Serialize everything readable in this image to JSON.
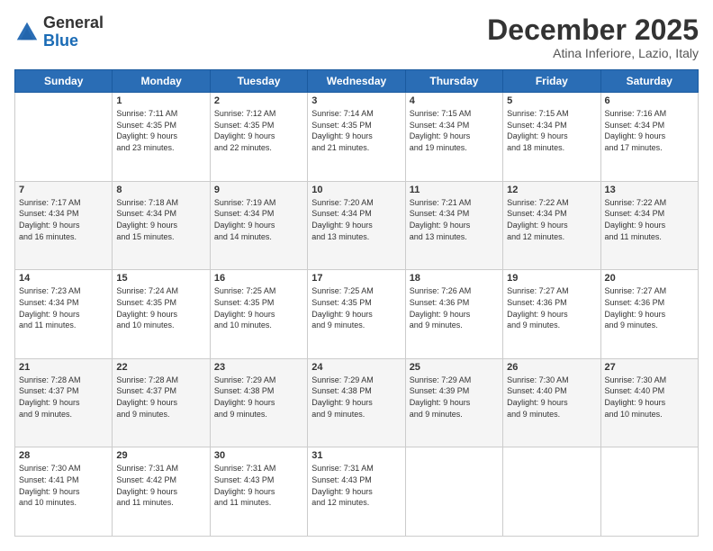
{
  "logo": {
    "general": "General",
    "blue": "Blue"
  },
  "header": {
    "month": "December 2025",
    "location": "Atina Inferiore, Lazio, Italy"
  },
  "days_of_week": [
    "Sunday",
    "Monday",
    "Tuesday",
    "Wednesday",
    "Thursday",
    "Friday",
    "Saturday"
  ],
  "weeks": [
    [
      {
        "day": "",
        "info": ""
      },
      {
        "day": "1",
        "info": "Sunrise: 7:11 AM\nSunset: 4:35 PM\nDaylight: 9 hours\nand 23 minutes."
      },
      {
        "day": "2",
        "info": "Sunrise: 7:12 AM\nSunset: 4:35 PM\nDaylight: 9 hours\nand 22 minutes."
      },
      {
        "day": "3",
        "info": "Sunrise: 7:14 AM\nSunset: 4:35 PM\nDaylight: 9 hours\nand 21 minutes."
      },
      {
        "day": "4",
        "info": "Sunrise: 7:15 AM\nSunset: 4:34 PM\nDaylight: 9 hours\nand 19 minutes."
      },
      {
        "day": "5",
        "info": "Sunrise: 7:15 AM\nSunset: 4:34 PM\nDaylight: 9 hours\nand 18 minutes."
      },
      {
        "day": "6",
        "info": "Sunrise: 7:16 AM\nSunset: 4:34 PM\nDaylight: 9 hours\nand 17 minutes."
      }
    ],
    [
      {
        "day": "7",
        "info": "Sunrise: 7:17 AM\nSunset: 4:34 PM\nDaylight: 9 hours\nand 16 minutes."
      },
      {
        "day": "8",
        "info": "Sunrise: 7:18 AM\nSunset: 4:34 PM\nDaylight: 9 hours\nand 15 minutes."
      },
      {
        "day": "9",
        "info": "Sunrise: 7:19 AM\nSunset: 4:34 PM\nDaylight: 9 hours\nand 14 minutes."
      },
      {
        "day": "10",
        "info": "Sunrise: 7:20 AM\nSunset: 4:34 PM\nDaylight: 9 hours\nand 13 minutes."
      },
      {
        "day": "11",
        "info": "Sunrise: 7:21 AM\nSunset: 4:34 PM\nDaylight: 9 hours\nand 13 minutes."
      },
      {
        "day": "12",
        "info": "Sunrise: 7:22 AM\nSunset: 4:34 PM\nDaylight: 9 hours\nand 12 minutes."
      },
      {
        "day": "13",
        "info": "Sunrise: 7:22 AM\nSunset: 4:34 PM\nDaylight: 9 hours\nand 11 minutes."
      }
    ],
    [
      {
        "day": "14",
        "info": "Sunrise: 7:23 AM\nSunset: 4:34 PM\nDaylight: 9 hours\nand 11 minutes."
      },
      {
        "day": "15",
        "info": "Sunrise: 7:24 AM\nSunset: 4:35 PM\nDaylight: 9 hours\nand 10 minutes."
      },
      {
        "day": "16",
        "info": "Sunrise: 7:25 AM\nSunset: 4:35 PM\nDaylight: 9 hours\nand 10 minutes."
      },
      {
        "day": "17",
        "info": "Sunrise: 7:25 AM\nSunset: 4:35 PM\nDaylight: 9 hours\nand 9 minutes."
      },
      {
        "day": "18",
        "info": "Sunrise: 7:26 AM\nSunset: 4:36 PM\nDaylight: 9 hours\nand 9 minutes."
      },
      {
        "day": "19",
        "info": "Sunrise: 7:27 AM\nSunset: 4:36 PM\nDaylight: 9 hours\nand 9 minutes."
      },
      {
        "day": "20",
        "info": "Sunrise: 7:27 AM\nSunset: 4:36 PM\nDaylight: 9 hours\nand 9 minutes."
      }
    ],
    [
      {
        "day": "21",
        "info": "Sunrise: 7:28 AM\nSunset: 4:37 PM\nDaylight: 9 hours\nand 9 minutes."
      },
      {
        "day": "22",
        "info": "Sunrise: 7:28 AM\nSunset: 4:37 PM\nDaylight: 9 hours\nand 9 minutes."
      },
      {
        "day": "23",
        "info": "Sunrise: 7:29 AM\nSunset: 4:38 PM\nDaylight: 9 hours\nand 9 minutes."
      },
      {
        "day": "24",
        "info": "Sunrise: 7:29 AM\nSunset: 4:38 PM\nDaylight: 9 hours\nand 9 minutes."
      },
      {
        "day": "25",
        "info": "Sunrise: 7:29 AM\nSunset: 4:39 PM\nDaylight: 9 hours\nand 9 minutes."
      },
      {
        "day": "26",
        "info": "Sunrise: 7:30 AM\nSunset: 4:40 PM\nDaylight: 9 hours\nand 9 minutes."
      },
      {
        "day": "27",
        "info": "Sunrise: 7:30 AM\nSunset: 4:40 PM\nDaylight: 9 hours\nand 10 minutes."
      }
    ],
    [
      {
        "day": "28",
        "info": "Sunrise: 7:30 AM\nSunset: 4:41 PM\nDaylight: 9 hours\nand 10 minutes."
      },
      {
        "day": "29",
        "info": "Sunrise: 7:31 AM\nSunset: 4:42 PM\nDaylight: 9 hours\nand 11 minutes."
      },
      {
        "day": "30",
        "info": "Sunrise: 7:31 AM\nSunset: 4:43 PM\nDaylight: 9 hours\nand 11 minutes."
      },
      {
        "day": "31",
        "info": "Sunrise: 7:31 AM\nSunset: 4:43 PM\nDaylight: 9 hours\nand 12 minutes."
      },
      {
        "day": "",
        "info": ""
      },
      {
        "day": "",
        "info": ""
      },
      {
        "day": "",
        "info": ""
      }
    ]
  ]
}
